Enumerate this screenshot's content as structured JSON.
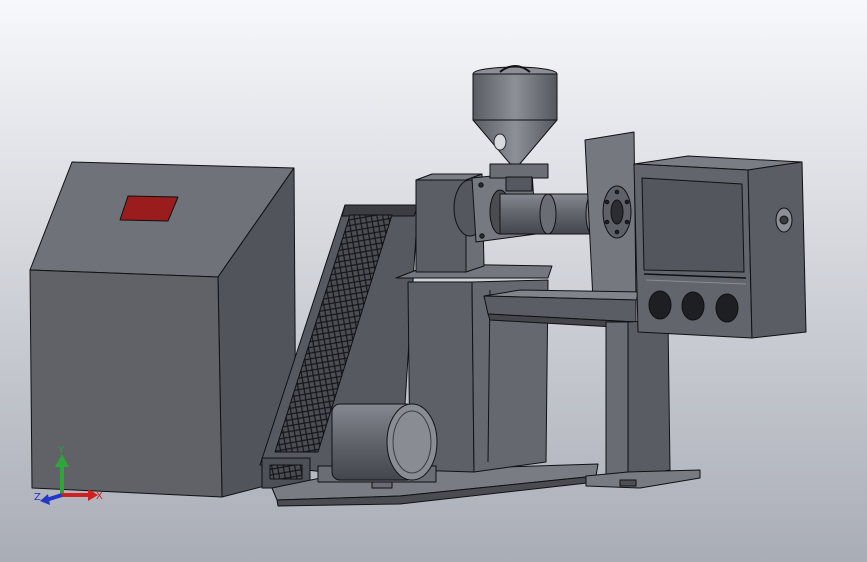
{
  "viewport": {
    "background_top": "#f7f8fb",
    "background_bottom": "#a9adb6",
    "model_body_color": "#5e6068",
    "model_edge_color": "#101114",
    "panel_accent_color": "#9a1c1c"
  },
  "triad": {
    "y_label": "Y",
    "x_label": "X",
    "z_label": "Z",
    "x_color": "#d21f1f",
    "y_color": "#2ea43a",
    "z_color": "#2437c8"
  }
}
